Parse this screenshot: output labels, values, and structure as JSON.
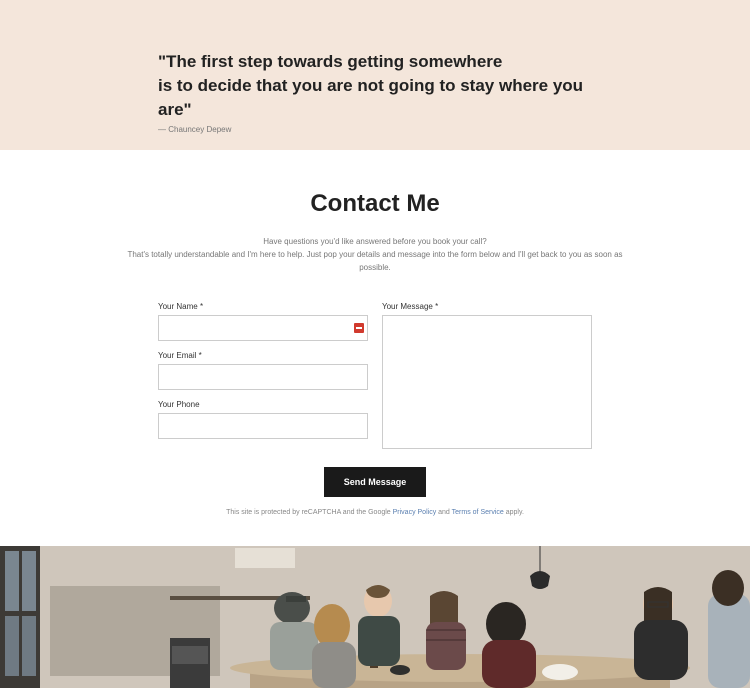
{
  "quote": {
    "line1": "\"The first step towards getting somewhere",
    "line2": "is to decide that you are not going to stay where you are\"",
    "author": "— Chauncey Depew"
  },
  "contact": {
    "title": "Contact Me",
    "sub1": "Have questions you'd like answered before you book your call?",
    "sub2": "That's totally understandable and I'm here to help. Just pop your details and message into the form below and I'll get back to you as soon as possible."
  },
  "form": {
    "name_label": "Your Name *",
    "email_label": "Your Email *",
    "phone_label": "Your Phone",
    "message_label": "Your Message *",
    "submit_label": "Send Message"
  },
  "legal": {
    "prefix": "This site is protected by reCAPTCHA and the Google ",
    "privacy": "Privacy Policy",
    "and": " and ",
    "tos": "Terms of Service",
    "suffix": " apply."
  }
}
